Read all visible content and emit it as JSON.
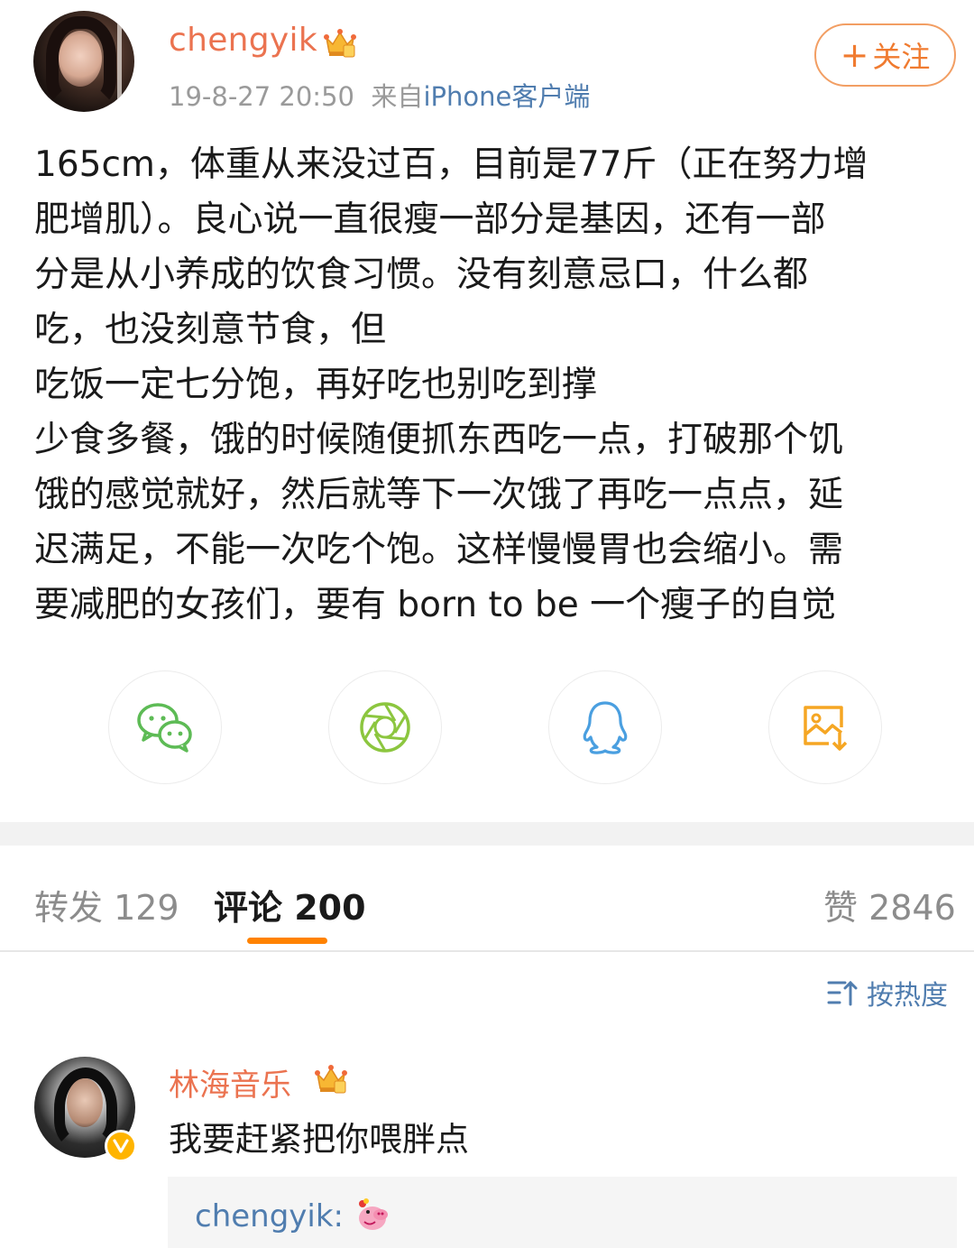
{
  "post": {
    "username": "chengyik",
    "timestamp": "19-8-27 20:50",
    "source_prefix": "来自",
    "source": "iPhone客户端",
    "follow_label": "关注",
    "follow_plus": "+",
    "text_lines": [
      "165cm，体重从来没过百，目前是77斤（正在努力增",
      "肥增肌）。良心说一直很瘦一部分是基因，还有一部",
      "分是从小养成的饮食习惯。没有刻意忌口，什么都",
      "吃，也没刻意节食，但",
      "吃饭一定七分饱，再好吃也别吃到撑",
      "少食多餐，饿的时候随便抓东西吃一点，打破那个饥",
      "饿的感觉就好，然后就等下一次饿了再吃一点点，延",
      "迟满足，不能一次吃个饱。这样慢慢胃也会缩小。需",
      "要减肥的女孩们，要有 born to be 一个瘦子的自觉"
    ]
  },
  "share": [
    {
      "name": "wechat-icon",
      "color": "#5dbb55"
    },
    {
      "name": "moments-icon",
      "color": "#8cc63f"
    },
    {
      "name": "qq-icon",
      "color": "#4a9fe0"
    },
    {
      "name": "save-image-icon",
      "color": "#f5a623"
    }
  ],
  "tabs": {
    "repost": "转发 129",
    "comments": "评论 200",
    "likes": "赞 2846"
  },
  "sort_label": "按热度",
  "comment": {
    "username": "林海音乐",
    "text": "我要赶紧把你喂胖点",
    "reply_user": "chengyik:"
  },
  "colors": {
    "accent": "#ff8200",
    "username": "#eb7350",
    "link": "#507daf"
  }
}
